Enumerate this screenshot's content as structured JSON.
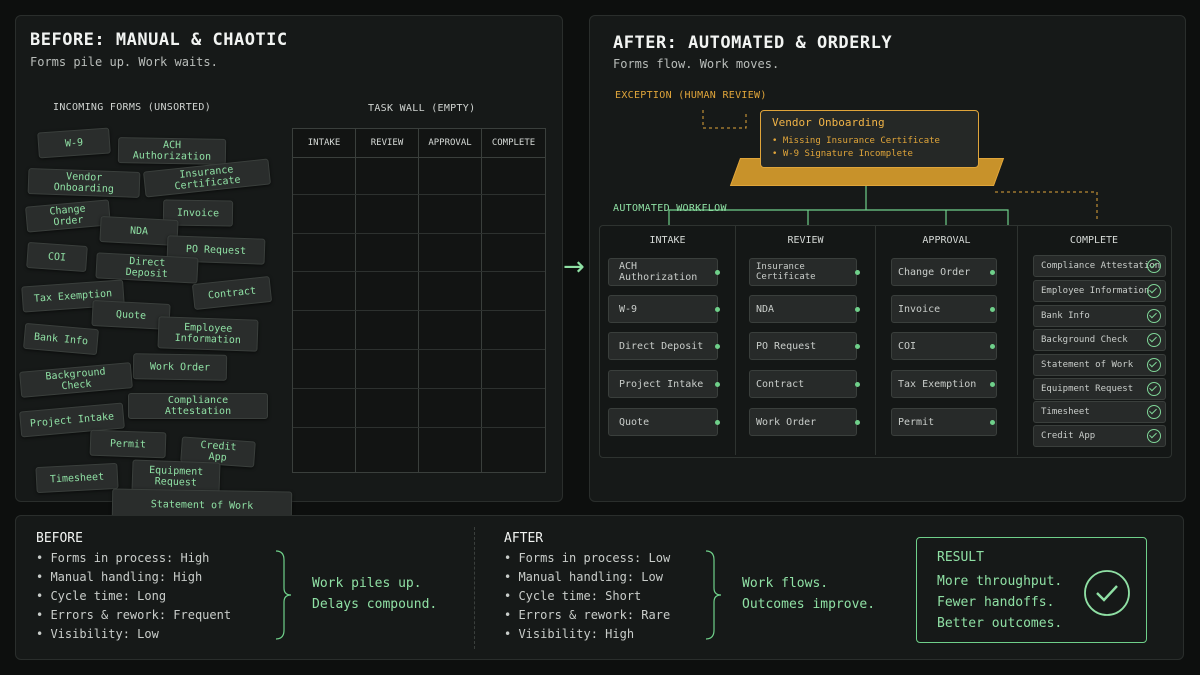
{
  "before": {
    "title": "BEFORE: MANUAL & CHAOTIC",
    "subtitle": "Forms pile up. Work waits.",
    "incoming_label": "INCOMING FORMS (UNSORTED)",
    "wall_label": "TASK WALL (EMPTY)",
    "wall_columns": [
      "INTAKE",
      "REVIEW",
      "APPROVAL",
      "COMPLETE"
    ],
    "forms": [
      "W-9",
      "ACH Authorization",
      "Vendor Onboarding",
      "Insurance Certificate",
      "Change Order",
      "Invoice",
      "NDA",
      "PO Request",
      "COI",
      "Direct Deposit",
      "Tax Exemption",
      "Contract",
      "Quote",
      "Employee Information",
      "Bank Info",
      "Work Order",
      "Background Check",
      "Compliance Attestation",
      "Project Intake",
      "Permit",
      "Credit App",
      "Timesheet",
      "Equipment Request",
      "Statement of Work"
    ]
  },
  "arrow": "→",
  "after": {
    "title": "AFTER: AUTOMATED & ORDERLY",
    "subtitle": "Forms flow. Work moves.",
    "exception_label": "EXCEPTION (HUMAN REVIEW)",
    "exception_card": {
      "title": "Vendor Onboarding",
      "items": [
        "• Missing Insurance Certificate",
        "• W-9 Signature Incomplete"
      ]
    },
    "workflow_label": "AUTOMATED WORKFLOW",
    "columns": [
      "INTAKE",
      "REVIEW",
      "APPROVAL",
      "COMPLETE"
    ],
    "intake": [
      "ACH Authorization",
      "W-9",
      "Direct Deposit",
      "Project Intake",
      "Quote"
    ],
    "review": [
      "Insurance Certificate",
      "NDA",
      "PO Request",
      "Contract",
      "Work Order"
    ],
    "approval": [
      "Change Order",
      "Invoice",
      "COI",
      "Tax Exemption",
      "Permit"
    ],
    "complete": [
      "Compliance Attestation",
      "Employee Information",
      "Bank Info",
      "Background Check",
      "Statement of Work",
      "Equipment Request",
      "Timesheet",
      "Credit App"
    ]
  },
  "summary": {
    "before": {
      "heading": "BEFORE",
      "items": [
        "• Forms in process: High",
        "• Manual handling: High",
        "• Cycle time: Long",
        "• Errors & rework: Frequent",
        "• Visibility: Low"
      ],
      "conclusion": [
        "Work piles up.",
        "Delays compound."
      ]
    },
    "after": {
      "heading": "AFTER",
      "items": [
        "• Forms in process: Low",
        "• Manual handling: Low",
        "• Cycle time: Short",
        "• Errors & rework: Rare",
        "• Visibility: High"
      ],
      "conclusion": [
        "Work flows.",
        "Outcomes improve."
      ]
    },
    "result": {
      "heading": "RESULT",
      "lines": [
        "More throughput.",
        "Fewer handoffs.",
        "Better outcomes."
      ]
    }
  },
  "colors": {
    "accent_green": "#8fe0a4",
    "exception_amber": "#e0a53a",
    "background": "#0d0f0e"
  }
}
